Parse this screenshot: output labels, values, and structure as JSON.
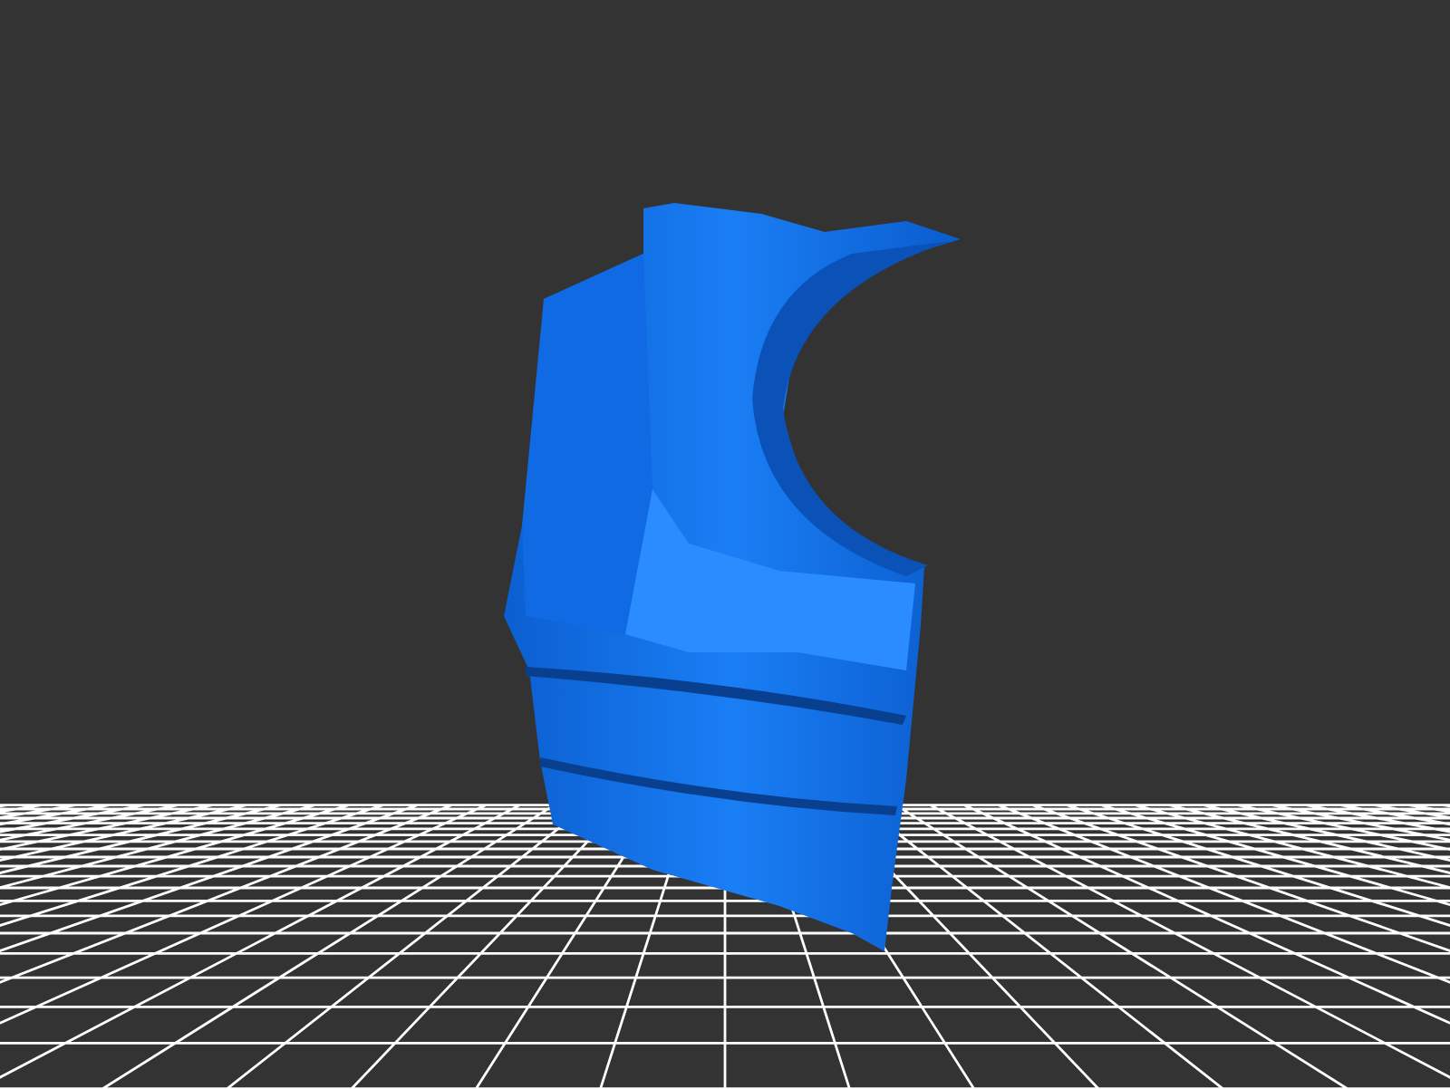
{
  "viewport": {
    "grid": true,
    "model": true
  }
}
